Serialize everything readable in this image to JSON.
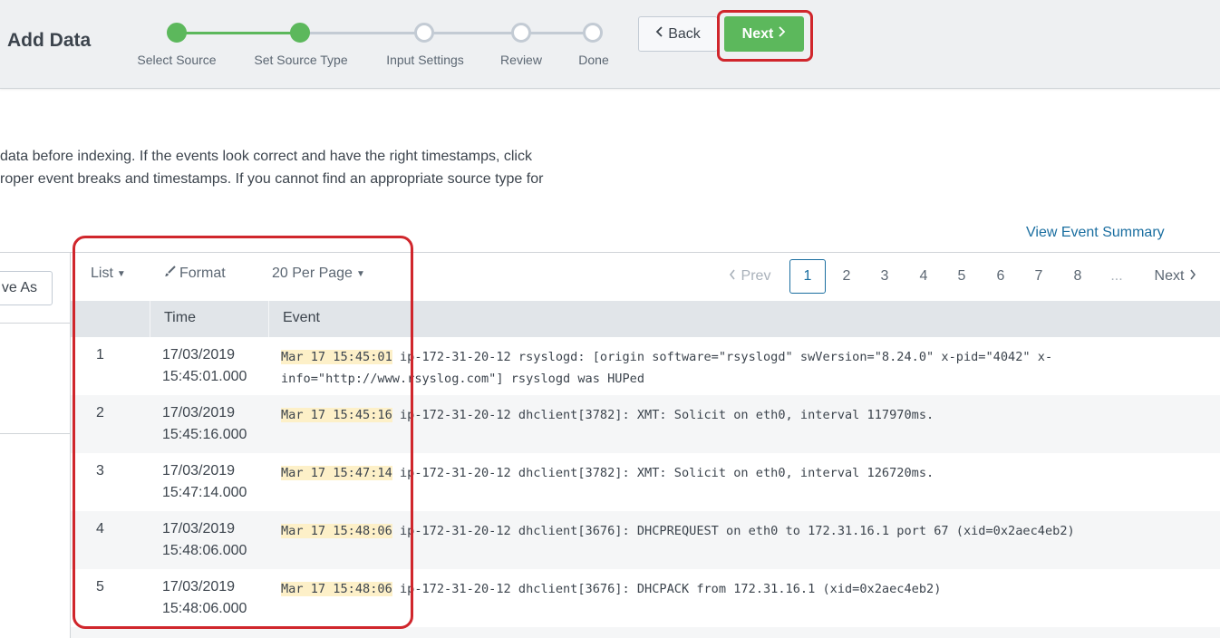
{
  "header": {
    "title": "Add Data",
    "steps": [
      {
        "label": "Select Source",
        "state": "done"
      },
      {
        "label": "Set Source Type",
        "state": "done"
      },
      {
        "label": "Input Settings",
        "state": "todo"
      },
      {
        "label": "Review",
        "state": "todo"
      },
      {
        "label": "Done",
        "state": "todo"
      }
    ],
    "back_label": "Back",
    "next_label": "Next"
  },
  "description": {
    "line1": "data before indexing. If the events look correct and have the right timestamps, click",
    "line2": "roper event breaks and timestamps. If you cannot find an appropriate source type for"
  },
  "view_event_summary": "View Event Summary",
  "left_panel": {
    "save_as_label": "ve As"
  },
  "toolbar": {
    "list_label": "List",
    "format_label": "Format",
    "per_page_label": "20 Per Page"
  },
  "pager": {
    "prev_label": "Prev",
    "pages": [
      "1",
      "2",
      "3",
      "4",
      "5",
      "6",
      "7",
      "8"
    ],
    "current_page": "1",
    "ellipsis": "...",
    "next_label": "Next"
  },
  "table": {
    "columns": [
      "Time",
      "Event"
    ],
    "rows": [
      {
        "num": "1",
        "date": "17/03/2019",
        "time": "15:45:01.000",
        "ts": "Mar 17 15:45:01",
        "rest": " ip-172-31-20-12 rsyslogd: [origin software=\"rsyslogd\" swVersion=\"8.24.0\" x-pid=\"4042\" x-info=\"http://www.rsyslog.com\"] rsyslogd was HUPed"
      },
      {
        "num": "2",
        "date": "17/03/2019",
        "time": "15:45:16.000",
        "ts": "Mar 17 15:45:16",
        "rest": " ip-172-31-20-12 dhclient[3782]: XMT: Solicit on eth0, interval 117970ms."
      },
      {
        "num": "3",
        "date": "17/03/2019",
        "time": "15:47:14.000",
        "ts": "Mar 17 15:47:14",
        "rest": " ip-172-31-20-12 dhclient[3782]: XMT: Solicit on eth0, interval 126720ms."
      },
      {
        "num": "4",
        "date": "17/03/2019",
        "time": "15:48:06.000",
        "ts": "Mar 17 15:48:06",
        "rest": " ip-172-31-20-12 dhclient[3676]: DHCPREQUEST on eth0 to 172.31.16.1 port 67 (xid=0x2aec4eb2)"
      },
      {
        "num": "5",
        "date": "17/03/2019",
        "time": "15:48:06.000",
        "ts": "Mar 17 15:48:06",
        "rest": " ip-172-31-20-12 dhclient[3676]: DHCPACK from 172.31.16.1 (xid=0x2aec4eb2)"
      }
    ]
  },
  "colors": {
    "accent_green": "#5cb85c",
    "link_blue": "#1a6ea0",
    "highlight_red": "#d0262c",
    "timestamp_bg": "#fdf0c8"
  }
}
